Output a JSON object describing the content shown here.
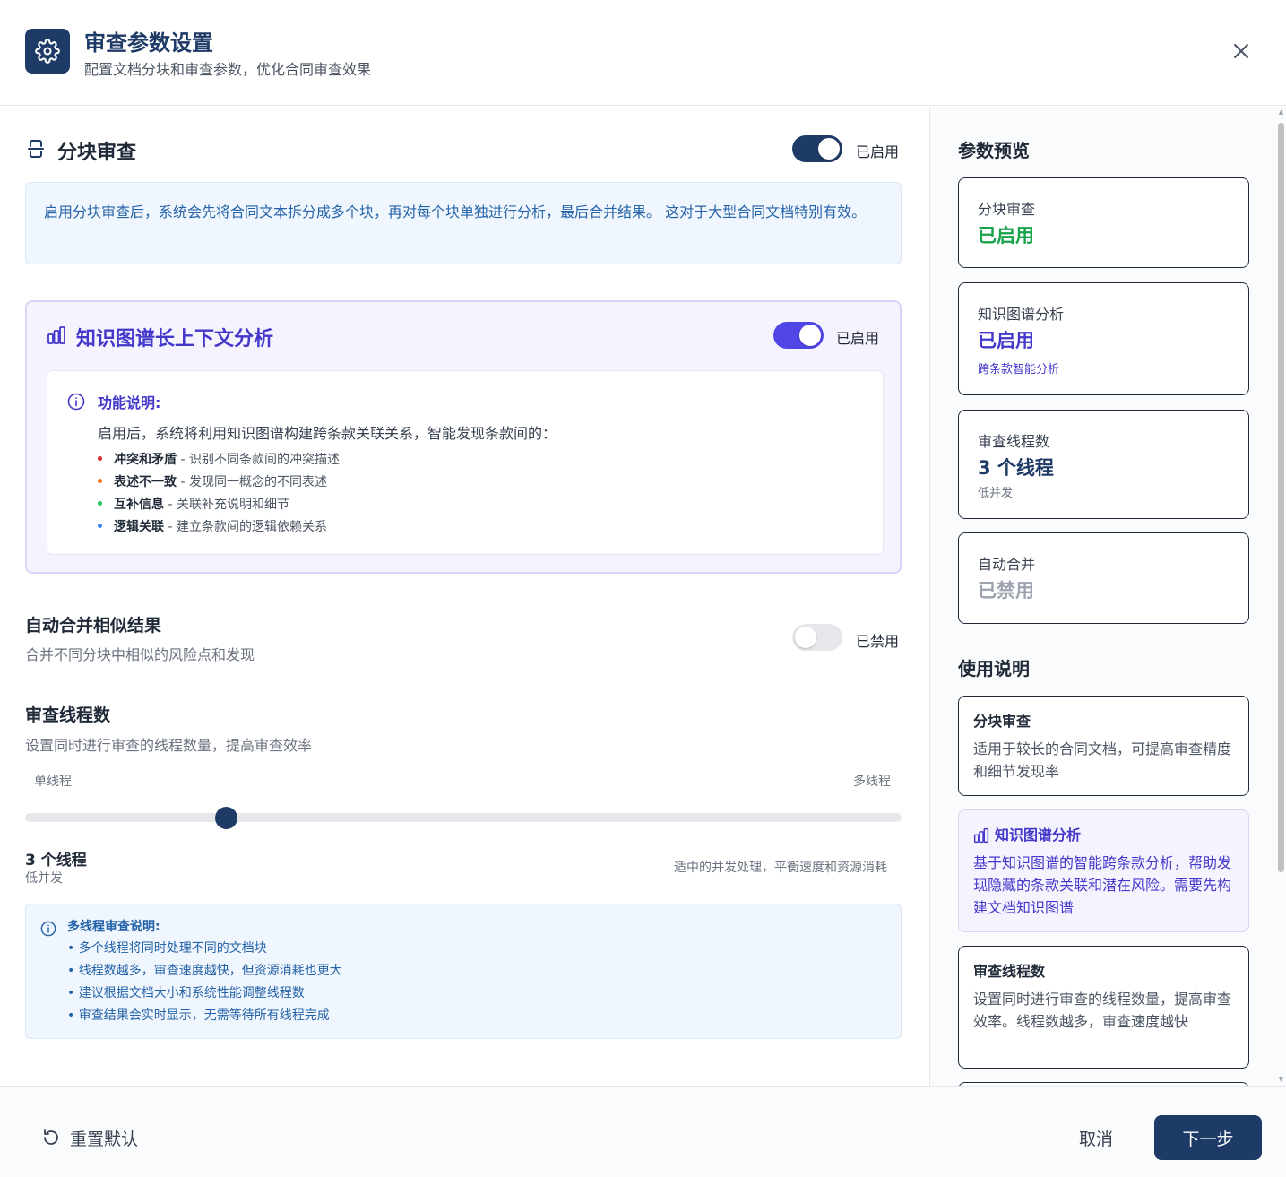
{
  "header": {
    "title": "审查参数设置",
    "subtitle": "配置文档分块和审查参数，优化合同审查效果",
    "icon": "gear-icon",
    "close_icon": "close-icon"
  },
  "chunk_review": {
    "title": "分块审查",
    "icon": "split-icon",
    "toggle_on": true,
    "status": "已启用",
    "description": "启用分块审查后，系统会先将合同文本拆分成多个块，再对每个块单独进行分析，最后合并结果。 这对于大型合同文档特别有效。"
  },
  "knowledge_graph": {
    "title": "知识图谱长上下文分析",
    "icon": "bar-chart-icon",
    "toggle_on": true,
    "status": "已启用",
    "desc_title": "功能说明:",
    "desc_text": "启用后，系统将利用知识图谱构建跨条款关联关系，智能发现条款间的：",
    "items": [
      {
        "bold": "冲突和矛盾",
        "text": " - 识别不同条款间的冲突描述",
        "color": "#dc2626"
      },
      {
        "bold": "表述不一致",
        "text": " - 发现同一概念的不同表述",
        "color": "#f97316"
      },
      {
        "bold": "互补信息",
        "text": " - 关联补充说明和细节",
        "color": "#22c55e"
      },
      {
        "bold": "逻辑关联",
        "text": " - 建立条款间的逻辑依赖关系",
        "color": "#3b82f6"
      }
    ]
  },
  "auto_merge": {
    "title": "自动合并相似结果",
    "description": "合并不同分块中相似的风险点和发现",
    "toggle_on": false,
    "status": "已禁用"
  },
  "threads": {
    "title": "审查线程数",
    "description": "设置同时进行审查的线程数量，提高审查效率",
    "min_label": "单线程",
    "max_label": "多线程",
    "value_fraction": 0.23,
    "value_label": "3 个线程",
    "level": "低并发",
    "hint": "适中的并发处理，平衡速度和资源消耗",
    "info_title": "多线程审查说明:",
    "info_items": [
      "• 多个线程将同时处理不同的文档块",
      "• 线程数越多，审查速度越快，但资源消耗也更大",
      "• 建议根据文档大小和系统性能调整线程数",
      "• 审查结果会实时显示，无需等待所有线程完成"
    ]
  },
  "preview": {
    "heading": "参数预览",
    "cards": [
      {
        "label": "分块审查",
        "value": "已启用",
        "note": "",
        "color": "#16a34a"
      },
      {
        "label": "知识图谱分析",
        "value": "已启用",
        "note": "跨条款智能分析",
        "color": "#4338ca"
      },
      {
        "label": "审查线程数",
        "value": "3 个线程",
        "note": "低并发",
        "color": "#1e3a66"
      },
      {
        "label": "自动合并",
        "value": "已禁用",
        "note": "",
        "color": "#9ca3af"
      }
    ]
  },
  "usage": {
    "heading": "使用说明",
    "cards": [
      {
        "title": "分块审查",
        "desc": "适用于较长的合同文档，可提高审查精度和细节发现率"
      },
      {
        "title": "知识图谱分析",
        "desc": "基于知识图谱的智能跨条款分析，帮助发现隐藏的条款关联和潜在风险。需要先构建文档知识图谱"
      },
      {
        "title": "审查线程数",
        "desc": "设置同时进行审查的线程数量，提高审查效率。线程数越多，审查速度越快"
      }
    ]
  },
  "footer": {
    "reset_label": "重置默认",
    "reset_icon": "reset-icon",
    "cancel_label": "取消",
    "next_label": "下一步"
  },
  "colors": {
    "primary": "#1e3a66",
    "toggle_on_chunk": "#1e3a66",
    "toggle_on_kg": "#4f46e5",
    "toggle_off": "#e5e7eb",
    "info_blue": "#2563a8",
    "kg_purple": "#4338ca"
  }
}
